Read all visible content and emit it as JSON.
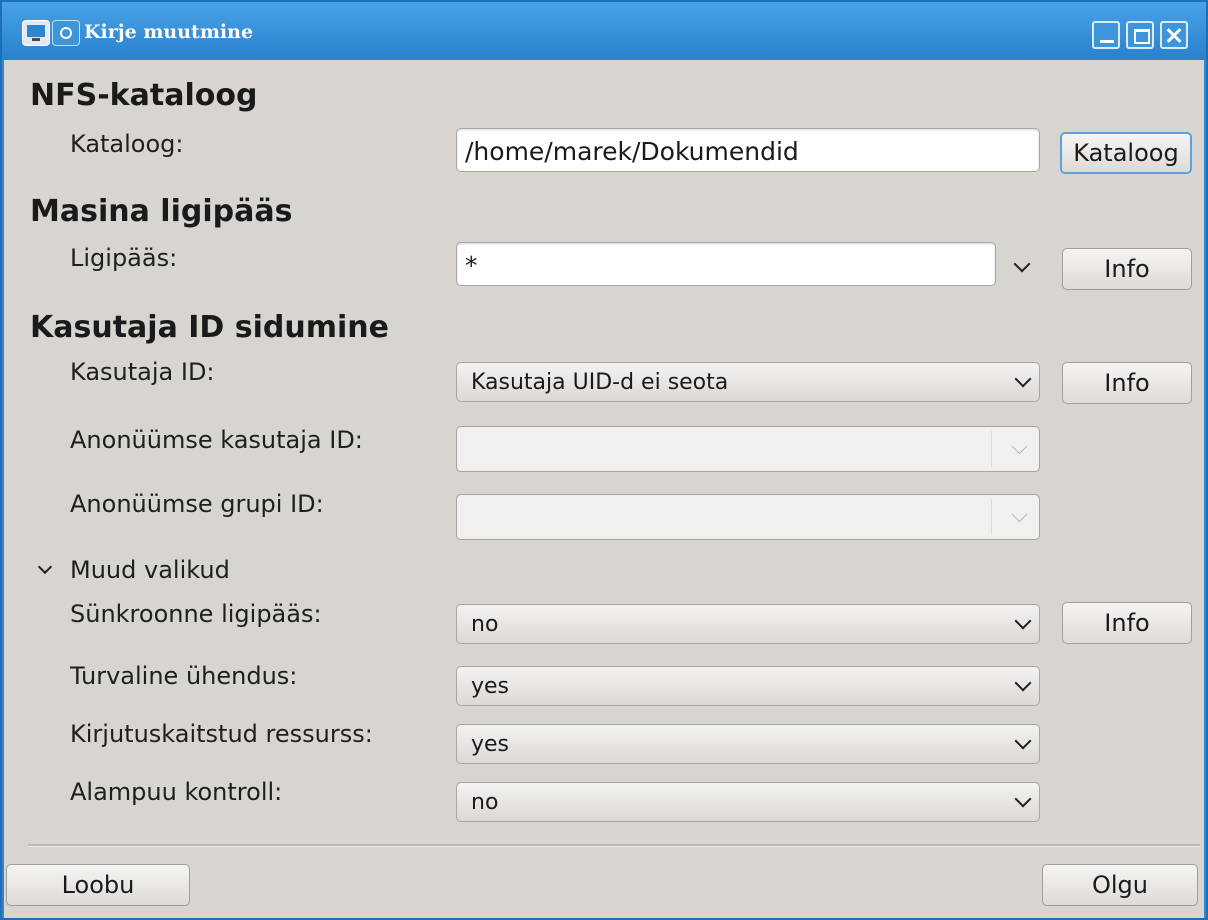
{
  "window": {
    "title": "Kirje muutmine"
  },
  "sections": {
    "nfs": "NFS-kataloog",
    "host": "Masina ligipääs",
    "uid": "Kasutaja ID sidumine"
  },
  "directory": {
    "label": "Kataloog:",
    "value": "/home/marek/Dokumendid",
    "button": "Kataloog"
  },
  "access": {
    "label": "Ligipääs:",
    "value": "*",
    "info": "Info"
  },
  "user_id": {
    "label": "Kasutaja ID:",
    "value": "Kasutaja UID-d ei seota",
    "info": "Info"
  },
  "anon_uid": {
    "label": "Anonüümse kasutaja ID:",
    "value": ""
  },
  "anon_gid": {
    "label": "Anonüümse grupi ID:",
    "value": ""
  },
  "other_options": {
    "toggle": "Muud valikud",
    "sync": {
      "label": "Sünkroonne ligipääs:",
      "value": "no",
      "info": "Info"
    },
    "secure": {
      "label": "Turvaline ühendus:",
      "value": "yes"
    },
    "readonly": {
      "label": "Kirjutuskaitstud ressurss:",
      "value": "yes"
    },
    "subtree": {
      "label": "Alampuu kontroll:",
      "value": "no"
    }
  },
  "footer": {
    "cancel": "Loobu",
    "ok": "Olgu"
  }
}
